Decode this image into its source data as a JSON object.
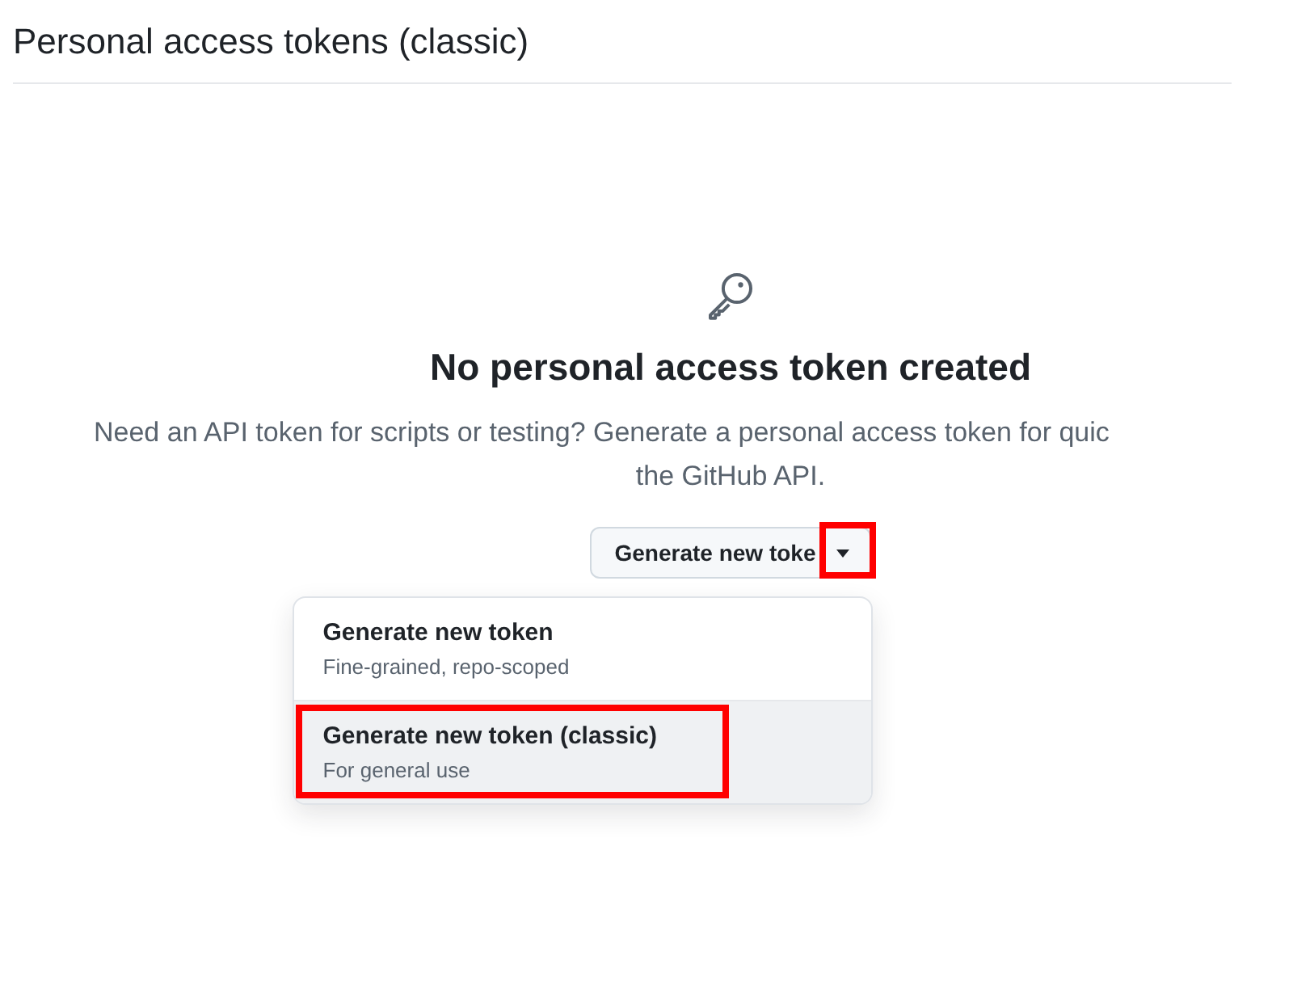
{
  "header": {
    "title": "Personal access tokens (classic)"
  },
  "empty_state": {
    "heading": "No personal access token created",
    "description_lines": [
      "Need an API token for scripts or testing? Generate a personal access token for quic",
      "the GitHub API."
    ]
  },
  "generate_button": {
    "label": "Generate new toke",
    "caret_highlighted": true
  },
  "menu": {
    "items": [
      {
        "title": "Generate new token",
        "description": "Fine-grained, repo-scoped",
        "selected": false,
        "highlighted": false
      },
      {
        "title": "Generate new token (classic)",
        "description": "For general use",
        "selected": true,
        "highlighted": true
      }
    ]
  }
}
